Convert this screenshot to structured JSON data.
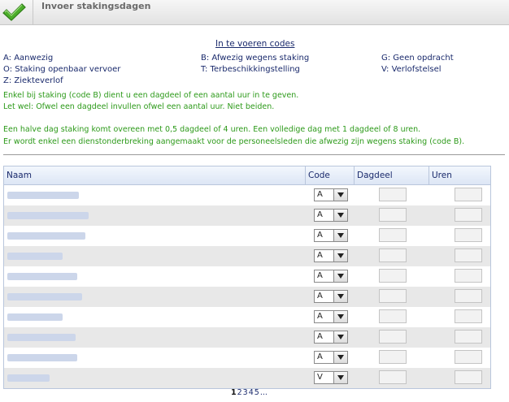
{
  "header": {
    "title": "Invoer stakingsdagen"
  },
  "codes": {
    "title": "In te voeren codes",
    "items": [
      "A: Aanwezig",
      "B: Afwezig wegens staking",
      "G: Geen opdracht",
      "O: Staking openbaar vervoer",
      "T: Terbeschikkingstelling",
      "V: Verlofstelsel",
      "Z: Ziekteverlof"
    ]
  },
  "notes": [
    "Enkel bij staking (code B) dient u een dagdeel of een aantal uur in te geven.",
    "Let wel: Ofwel een dagdeel invullen ofwel een aantal uur. Niet beiden.",
    "Een halve dag staking komt overeen met 0,5 dagdeel of 4 uren. Een volledige dag met 1 dagdeel of 8 uren.",
    "Er wordt enkel een dienstonderbreking aangemaakt voor de personeelsleden die afwezig zijn wegens staking (code B)."
  ],
  "table": {
    "headers": {
      "naam": "Naam",
      "code": "Code",
      "dagdeel": "Dagdeel",
      "uren": "Uren"
    },
    "rows": [
      {
        "code": "A"
      },
      {
        "code": "A"
      },
      {
        "code": "A"
      },
      {
        "code": "A"
      },
      {
        "code": "A"
      },
      {
        "code": "A"
      },
      {
        "code": "A"
      },
      {
        "code": "A"
      },
      {
        "code": "A"
      },
      {
        "code": "V"
      }
    ]
  },
  "pager": {
    "pages": [
      "1",
      "2",
      "3",
      "4",
      "5",
      "..."
    ],
    "current": "1"
  }
}
